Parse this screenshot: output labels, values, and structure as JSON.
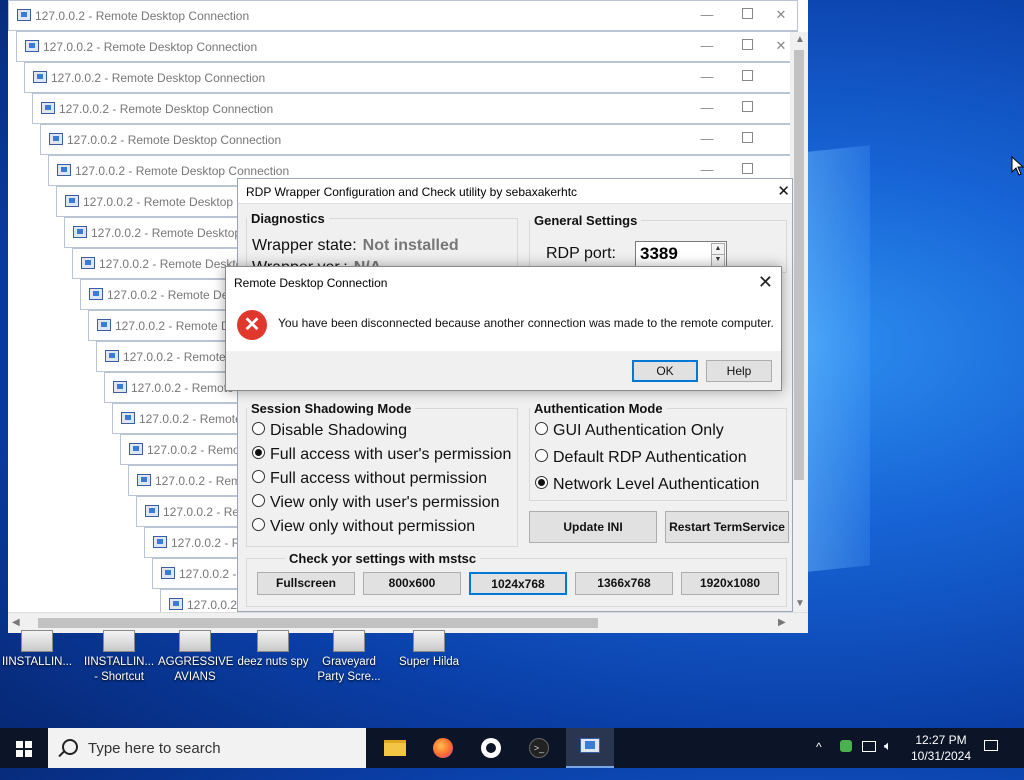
{
  "cascade": {
    "window_title": "127.0.0.2 - Remote Desktop Connection",
    "count": 20
  },
  "wrapper": {
    "title": "RDP Wrapper Configuration and Check utility by sebaxakerhtc",
    "diagnostics_label": "Diagnostics",
    "wrapper_state_label": "Wrapper state:",
    "wrapper_state_value": "Not installed",
    "wrapper_ver_label": "Wrapper ver.:",
    "wrapper_ver_value": "N/A",
    "general_settings_label": "General Settings",
    "rdp_port_label": "RDP port:",
    "rdp_port_value": "3389",
    "shadowing": {
      "label": "Session Shadowing Mode",
      "options": [
        "Disable Shadowing",
        "Full access with user's permission",
        "Full access without permission",
        "View only with user's permission",
        "View only without permission"
      ],
      "selected_index": 1
    },
    "auth": {
      "label": "Authentication Mode",
      "options": [
        "GUI Authentication Only",
        "Default RDP Authentication",
        "Network Level Authentication"
      ],
      "selected_index": 2
    },
    "update_ini": "Update INI",
    "restart_termservice": "Restart TermService",
    "check_label": "Check yor settings with mstsc",
    "resolutions": [
      "Fullscreen",
      "800x600",
      "1024x768",
      "1366x768",
      "1920x1080"
    ],
    "focused_resolution": "1024x768"
  },
  "dialog": {
    "title": "Remote Desktop Connection",
    "message": "You have been disconnected because another connection was made to the remote computer.",
    "ok": "OK",
    "help": "Help"
  },
  "desktop_icons": [
    {
      "label": "IINSTALLIN...",
      "icon": "installer-icon"
    },
    {
      "label": "IINSTALLIN... - Shortcut",
      "icon": "installer-shortcut-icon"
    },
    {
      "label": "AGGRESSIVE AVIANS",
      "icon": "game-icon"
    },
    {
      "label": "deez nuts spy",
      "icon": "shortcut-icon"
    },
    {
      "label": "Graveyard Party Scre...",
      "icon": "game-icon"
    },
    {
      "label": "Super Hilda",
      "icon": "game-icon"
    }
  ],
  "taskbar": {
    "search_placeholder": "Type here to search",
    "apps": [
      "file-explorer-icon",
      "firefox-icon",
      "github-icon",
      "terminal-icon",
      "remote-desktop-icon"
    ],
    "time": "12:27 PM",
    "date": "10/31/2024"
  }
}
